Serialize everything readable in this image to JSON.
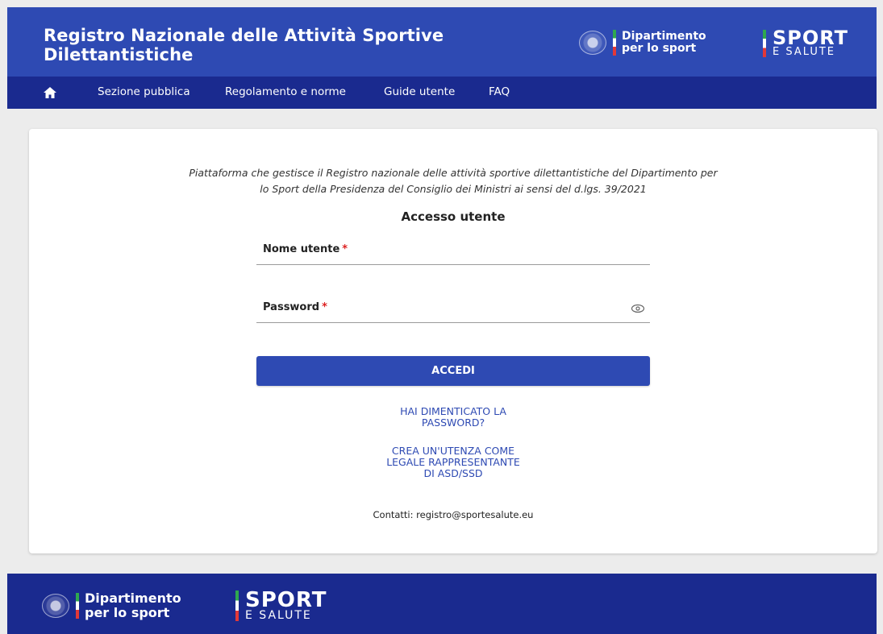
{
  "header": {
    "title": "Registro Nazionale delle Attività Sportive Dilettantistiche",
    "dipartimento_line1": "Dipartimento",
    "dipartimento_line2": "per lo sport",
    "sport_line1": "SPORT",
    "sport_line2": "E SALUTE"
  },
  "nav": {
    "items": [
      {
        "label": "Sezione pubblica"
      },
      {
        "label": "Regolamento e norme"
      },
      {
        "label": "Guide utente"
      },
      {
        "label": "FAQ"
      }
    ]
  },
  "login": {
    "intro_line1": "Piattaforma che gestisce il Registro nazionale delle attività sportive dilettantistiche del Dipartimento per",
    "intro_line2": "lo Sport della Presidenza del Consiglio dei Ministri ai sensi del d.lgs. 39/2021",
    "title": "Accesso utente",
    "username_label": "Nome utente",
    "password_label": "Password",
    "required_mark": "*",
    "submit_label": "ACCEDI",
    "forgot_line1": "HAI DIMENTICATO LA",
    "forgot_line2": "PASSWORD?",
    "create_line1": "CREA UN'UTENZA COME",
    "create_line2": "LEGALE RAPPRESENTANTE",
    "create_line3": "DI ASD/SSD",
    "contact": "Contatti: registro@sportesalute.eu"
  },
  "footer": {
    "dipartimento_line1": "Dipartimento",
    "dipartimento_line2": "per lo sport",
    "sport_line1": "SPORT",
    "sport_line2": "E SALUTE"
  },
  "colors": {
    "header_bg": "#2e4ab3",
    "nav_bg": "#1a2a8f",
    "accent": "#2e4ab3",
    "required": "#dd2222"
  }
}
